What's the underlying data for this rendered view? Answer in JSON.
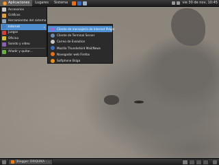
{
  "top_panel": {
    "menus": [
      "Aplicaciones",
      "Lugares",
      "Sistema"
    ],
    "clock": "vie 30 de nov, 10:45"
  },
  "main_menu": {
    "items": [
      {
        "label": "Accesorios",
        "icon": "accessories-icon",
        "color": "#c9c9c9"
      },
      {
        "label": "Gráficos",
        "icon": "graphics-icon",
        "color": "#e0a040"
      },
      {
        "label": "Herramientas del sistema",
        "icon": "system-tools-icon",
        "color": "#8aa0b8"
      },
      {
        "label": "Internet",
        "icon": "internet-icon",
        "color": "#4a80c0"
      },
      {
        "label": "Juegos",
        "icon": "games-icon",
        "color": "#d04040"
      },
      {
        "label": "Oficina",
        "icon": "office-icon",
        "color": "#d0c040"
      },
      {
        "label": "Sonido y vídeo",
        "icon": "sound-video-icon",
        "color": "#8a60b0"
      }
    ],
    "add_remove": "Añadir y quitar..."
  },
  "internet_menu": {
    "items": [
      {
        "label": "Cliente de mensajería de Internet Pidgin",
        "icon": "pidgin-icon",
        "color": "#9a6ad0"
      },
      {
        "label": "Cliente de Terminal Server",
        "icon": "terminal-server-icon",
        "color": "#6a8ab0"
      },
      {
        "label": "Correo de Evolution",
        "icon": "evolution-icon",
        "color": "#c8c8c8"
      },
      {
        "label": "Mozilla Thunderbird Mail/News",
        "icon": "thunderbird-icon",
        "color": "#3a6ab8"
      },
      {
        "label": "Navegador web Firefox",
        "icon": "firefox-icon",
        "color": "#e8701a"
      },
      {
        "label": "Softphone Ekiga",
        "icon": "ekiga-icon",
        "color": "#e89020"
      }
    ]
  },
  "bottom_panel": {
    "taskbar_item": "[Blogger: DRIQUIKA - ..."
  }
}
